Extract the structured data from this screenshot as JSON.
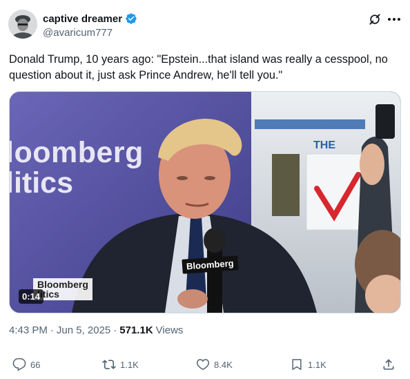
{
  "author": {
    "display_name": "captive dreamer",
    "handle": "@avaricum777",
    "verified_icon": "verified-badge-icon"
  },
  "tweet": {
    "text": "Donald Trump, 10 years ago:  \"Epstein...that island was really a cesspool, no question about it, just ask Prince Andrew, he'll tell you.\""
  },
  "media": {
    "duration": "0:14",
    "background_brand_line1": "loomberg",
    "background_brand_line2": "litics",
    "lower_third_line1": "Bloomberg",
    "lower_third_line2": "litics",
    "mic_label": "Bloomberg",
    "side_sign": "THE"
  },
  "meta": {
    "time": "4:43 PM",
    "separator": "·",
    "date": "Jun 5, 2025",
    "views_count": "571.1K",
    "views_label": "Views"
  },
  "actions": {
    "reply_count": "66",
    "repost_count": "1.1K",
    "like_count": "8.4K",
    "bookmark_count": "1.1K"
  },
  "colors": {
    "verified": "#1d9bf0",
    "text": "#0f1419",
    "secondary": "#536471"
  }
}
